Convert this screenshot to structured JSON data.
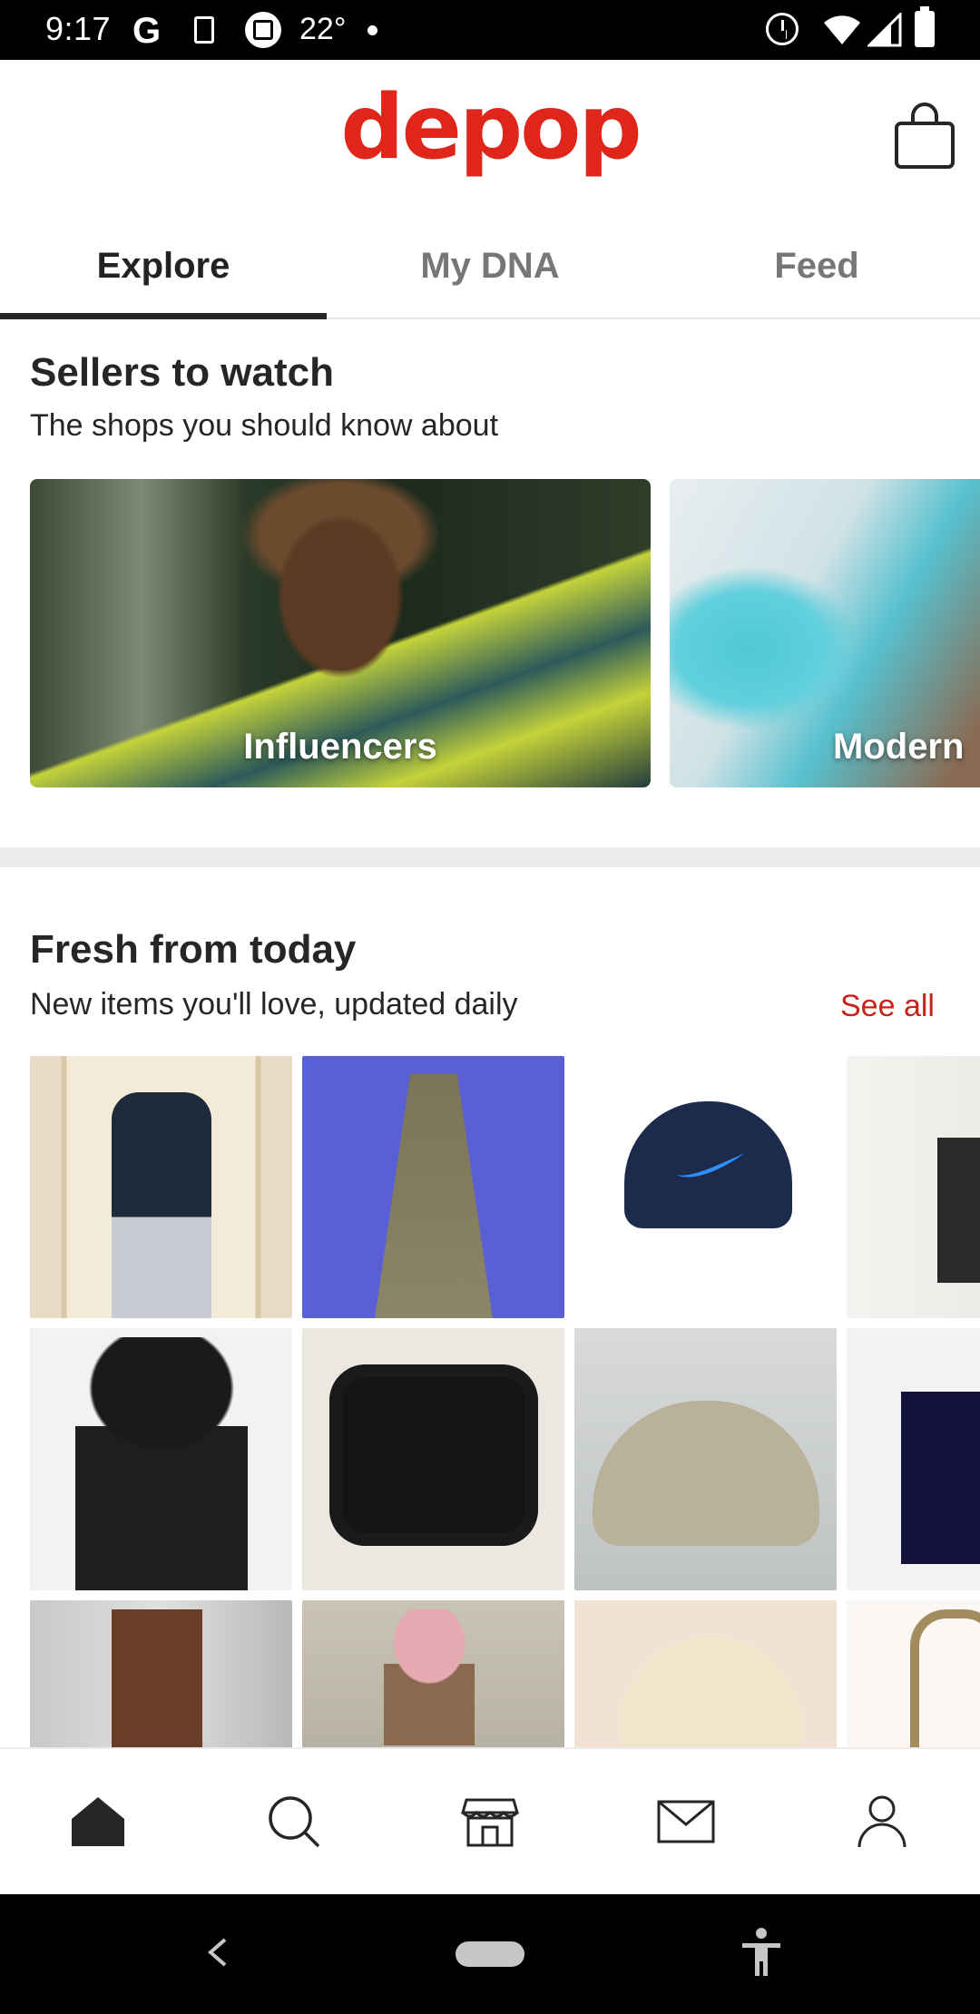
{
  "status_bar": {
    "time": "9:17",
    "g_label": "G",
    "temperature": "22°"
  },
  "header": {
    "logo": "depop",
    "brand_color": "#e0261a"
  },
  "tabs": [
    {
      "label": "Explore",
      "active": true
    },
    {
      "label": "My DNA",
      "active": false
    },
    {
      "label": "Feed",
      "active": false
    }
  ],
  "sellers": {
    "title": "Sellers to watch",
    "subtitle": "The shops you should know about",
    "cards": [
      {
        "label": "Influencers"
      },
      {
        "label": "Modern"
      }
    ]
  },
  "fresh": {
    "title": "Fresh from today",
    "subtitle": "New items you'll love, updated daily",
    "see_all": "See all"
  },
  "bottom_nav": {
    "items": [
      "home-icon",
      "search-icon",
      "shop-icon",
      "mail-icon",
      "profile-icon"
    ],
    "active": "home-icon"
  }
}
